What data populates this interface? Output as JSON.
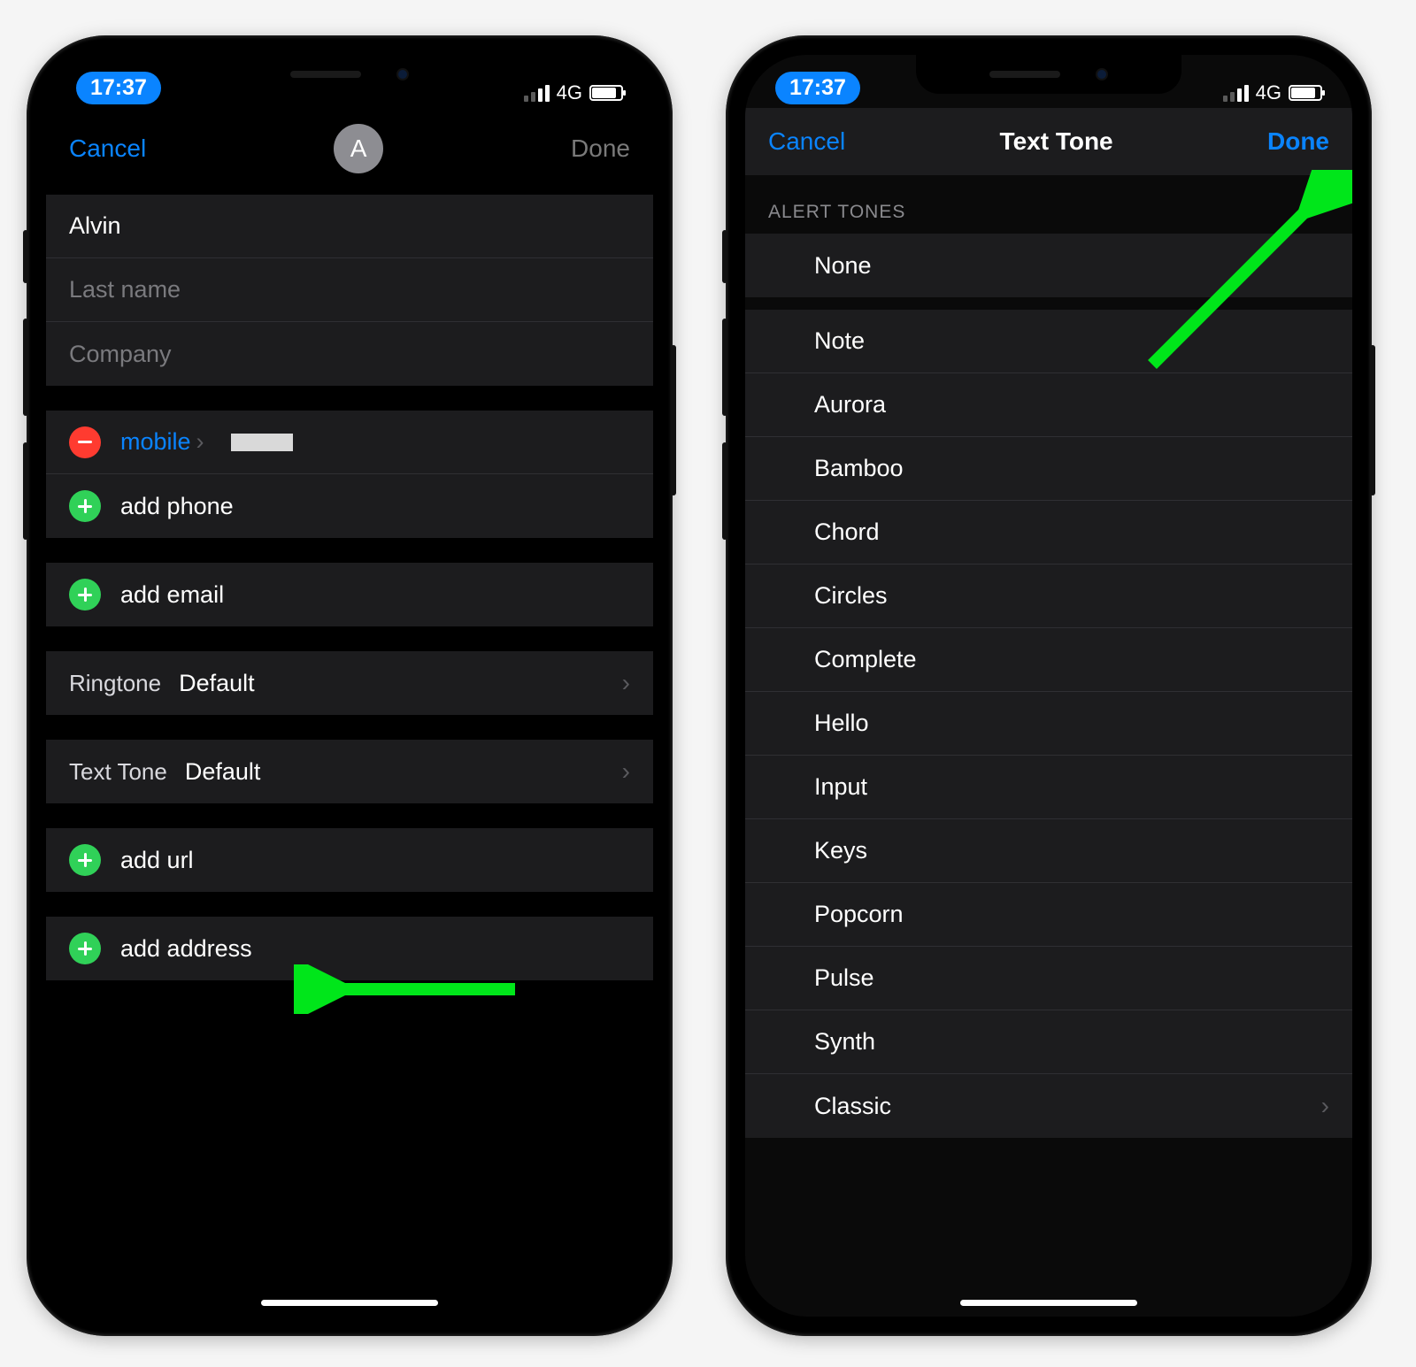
{
  "statusbar": {
    "time": "17:37",
    "network": "4G"
  },
  "left": {
    "nav": {
      "cancel": "Cancel",
      "done": "Done",
      "avatar_initial": "A"
    },
    "fields": {
      "first_name_value": "Alvin",
      "last_name_placeholder": "Last name",
      "company_placeholder": "Company"
    },
    "phone": {
      "type_label": "mobile",
      "add_phone": "add phone"
    },
    "email": {
      "add_email": "add email"
    },
    "ringtone": {
      "label": "Ringtone",
      "value": "Default"
    },
    "texttone": {
      "label": "Text Tone",
      "value": "Default"
    },
    "url": {
      "add_url": "add url"
    },
    "address": {
      "add_address": "add address"
    }
  },
  "right": {
    "nav": {
      "cancel": "Cancel",
      "title": "Text Tone",
      "done": "Done"
    },
    "section_header": "ALERT TONES",
    "tones_top": [
      "None"
    ],
    "tones": [
      "Note",
      "Aurora",
      "Bamboo",
      "Chord",
      "Circles",
      "Complete",
      "Hello",
      "Input",
      "Keys",
      "Popcorn",
      "Pulse",
      "Synth",
      "Classic"
    ]
  },
  "colors": {
    "accent_blue": "#0a84ff",
    "accent_green": "#30d158",
    "accent_red": "#ff3b30",
    "arrow_green": "#00e61a"
  }
}
